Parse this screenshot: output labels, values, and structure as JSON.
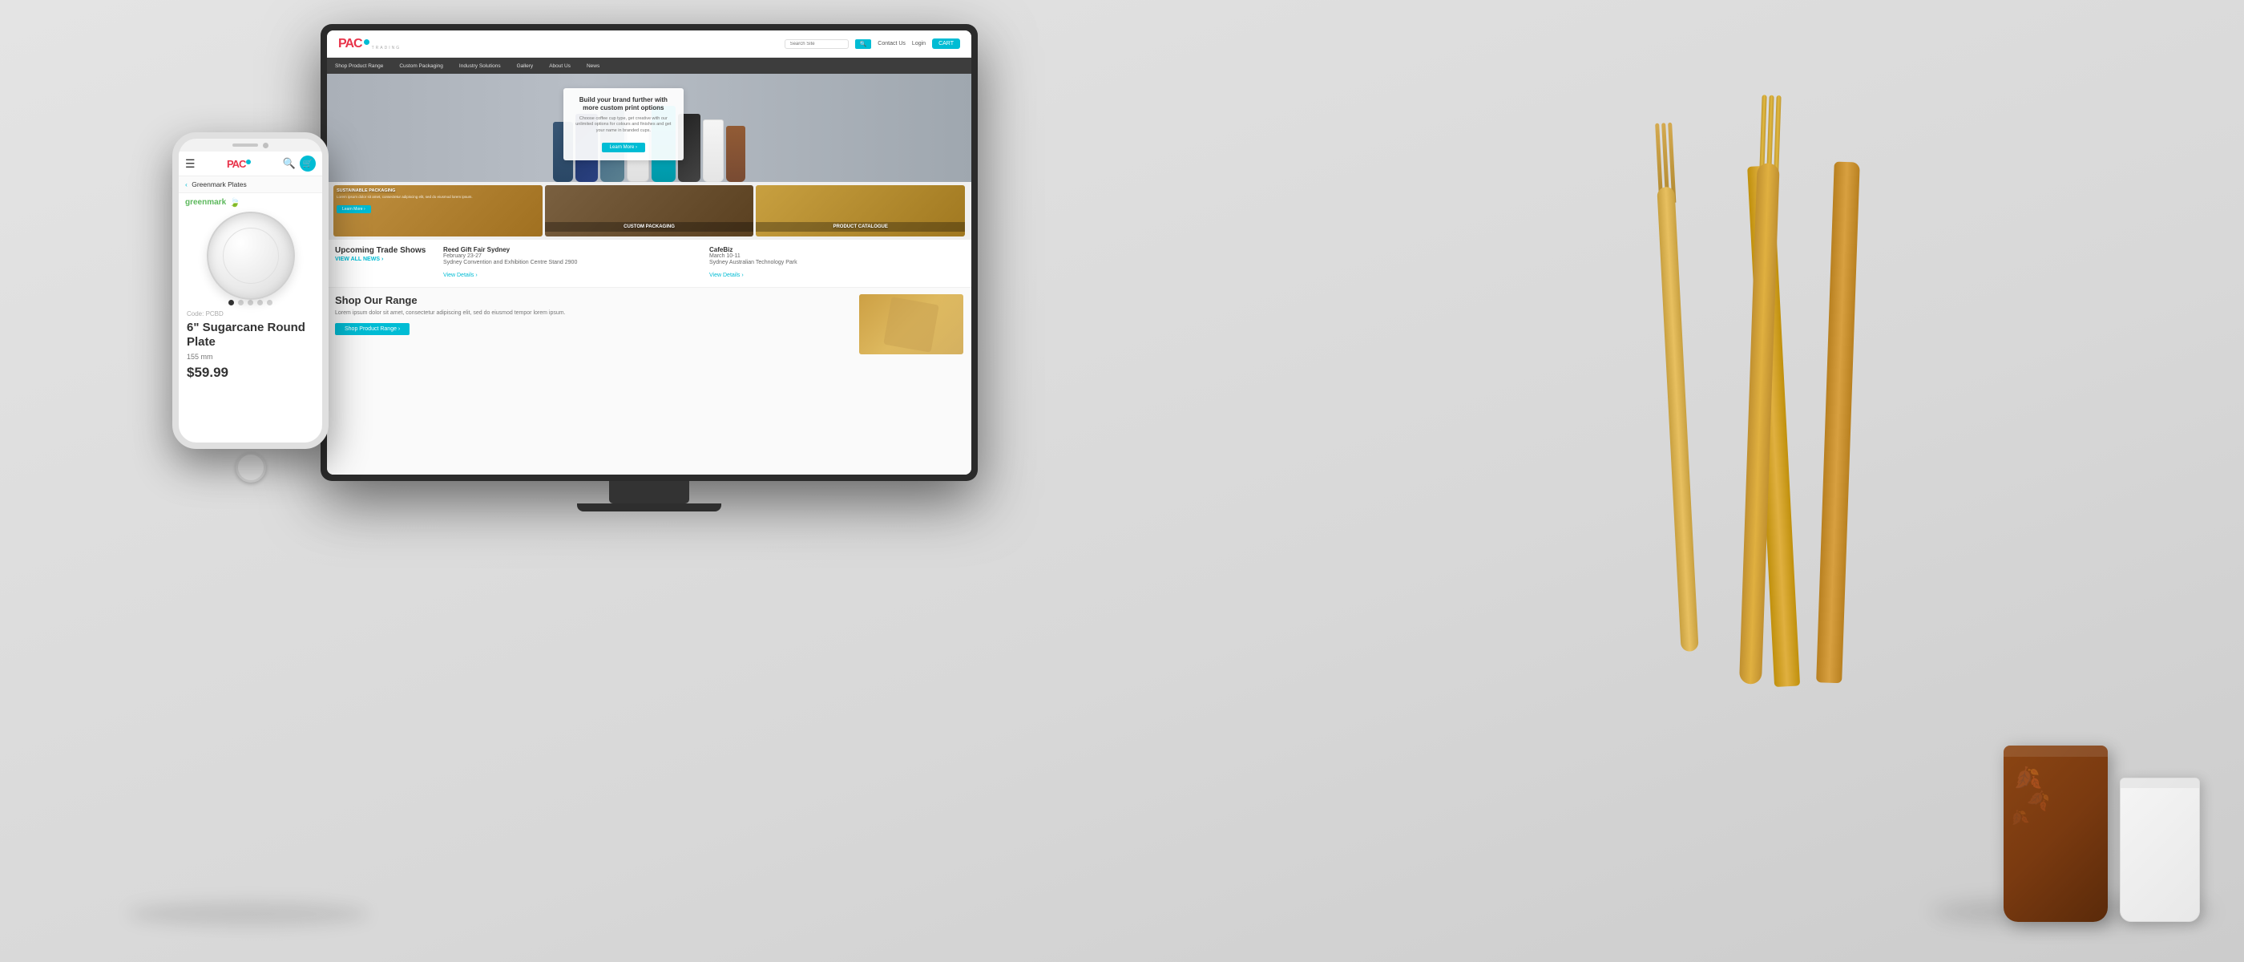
{
  "site": {
    "logo": {
      "brand": "PAC",
      "tagline": "TRADING"
    },
    "header": {
      "search_placeholder": "Search Site",
      "contact_label": "Contact Us",
      "login_label": "Login",
      "cart_label": "CART"
    },
    "nav": {
      "items": [
        {
          "label": "Shop Product Range"
        },
        {
          "label": "Custom Packaging"
        },
        {
          "label": "Industry Solutions"
        },
        {
          "label": "Gallery"
        },
        {
          "label": "About Us"
        },
        {
          "label": "News"
        }
      ]
    },
    "hero": {
      "title": "Build your brand further with more custom print options",
      "description": "Choose coffee cup type, get creative with our unlimited options for colours and finishes and get your name in branded cups.",
      "cta": "Learn More ›"
    },
    "categories": [
      {
        "id": "sustainable",
        "label": "SUSTAINABLE PACKAGING",
        "sub": "Lorem ipsum dolor sit amet, consectetur adipiscing elit, sed do eiusmod lorem ipsum."
      },
      {
        "id": "custom",
        "label": "CUSTOM PACKAGING",
        "sub": ""
      },
      {
        "id": "catalogue",
        "label": "PRODUCT CATALOGUE",
        "sub": ""
      }
    ],
    "trade_shows": {
      "section_title": "Upcoming Trade Shows",
      "view_all_label": "VIEW ALL NEWS ›",
      "events": [
        {
          "name": "Reed Gift Fair Sydney",
          "dates": "February 23-27",
          "venue": "Sydney Convention and Exhibition Centre Stand 2900",
          "link": "View Details ›"
        },
        {
          "name": "CafeBiz",
          "dates": "March 10-11",
          "venue": "Sydney Australian Technology Park",
          "link": "View Details ›"
        }
      ]
    },
    "shop_range": {
      "title": "Shop Our Range",
      "description": "Lorem ipsum dolor sit amet, consectetur adipiscing elit, sed do eiusmod tempor lorem ipsum.",
      "cta": "Shop Product Range ›"
    }
  },
  "phone": {
    "breadcrumb": "Greenmark Plates",
    "brand": "greenmark",
    "product": {
      "code": "Code: PCBD",
      "name": "6\" Sugarcane Round Plate",
      "size": "155 mm",
      "price": "$59.99"
    }
  },
  "decorative": {
    "cups_label": "Coffee Cups",
    "cutlery_label": "Wooden Cutlery"
  }
}
